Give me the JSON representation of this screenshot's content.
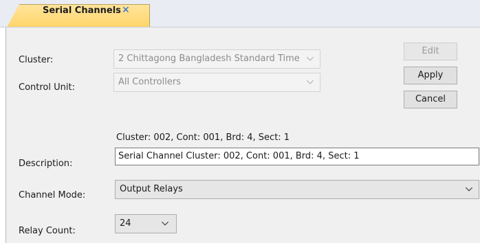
{
  "tab": {
    "label": "Serial Channels",
    "close_glyph": "✕",
    "close_icon": "close-icon"
  },
  "form": {
    "cluster_label": "Cluster:",
    "cluster_value": "2 Chittagong Bangladesh Standard Time",
    "control_unit_label": "Control Unit:",
    "control_unit_value": "All Controllers",
    "info_text": "Cluster: 002, Cont: 001, Brd: 4, Sect: 1",
    "description_label": "Description:",
    "description_value": "Serial Channel Cluster: 002, Cont: 001, Brd: 4, Sect: 1",
    "channel_mode_label": "Channel Mode:",
    "channel_mode_value": "Output Relays",
    "relay_count_label": "Relay Count:",
    "relay_count_value": "24"
  },
  "buttons": {
    "edit": "Edit",
    "apply": "Apply",
    "cancel": "Cancel"
  },
  "colors": {
    "tab_active": "#ffd56a",
    "panel_bg": "#f0f0f0",
    "close_icon": "#2b6fd6"
  },
  "icons": {
    "dropdown": "chevron-down-icon"
  }
}
